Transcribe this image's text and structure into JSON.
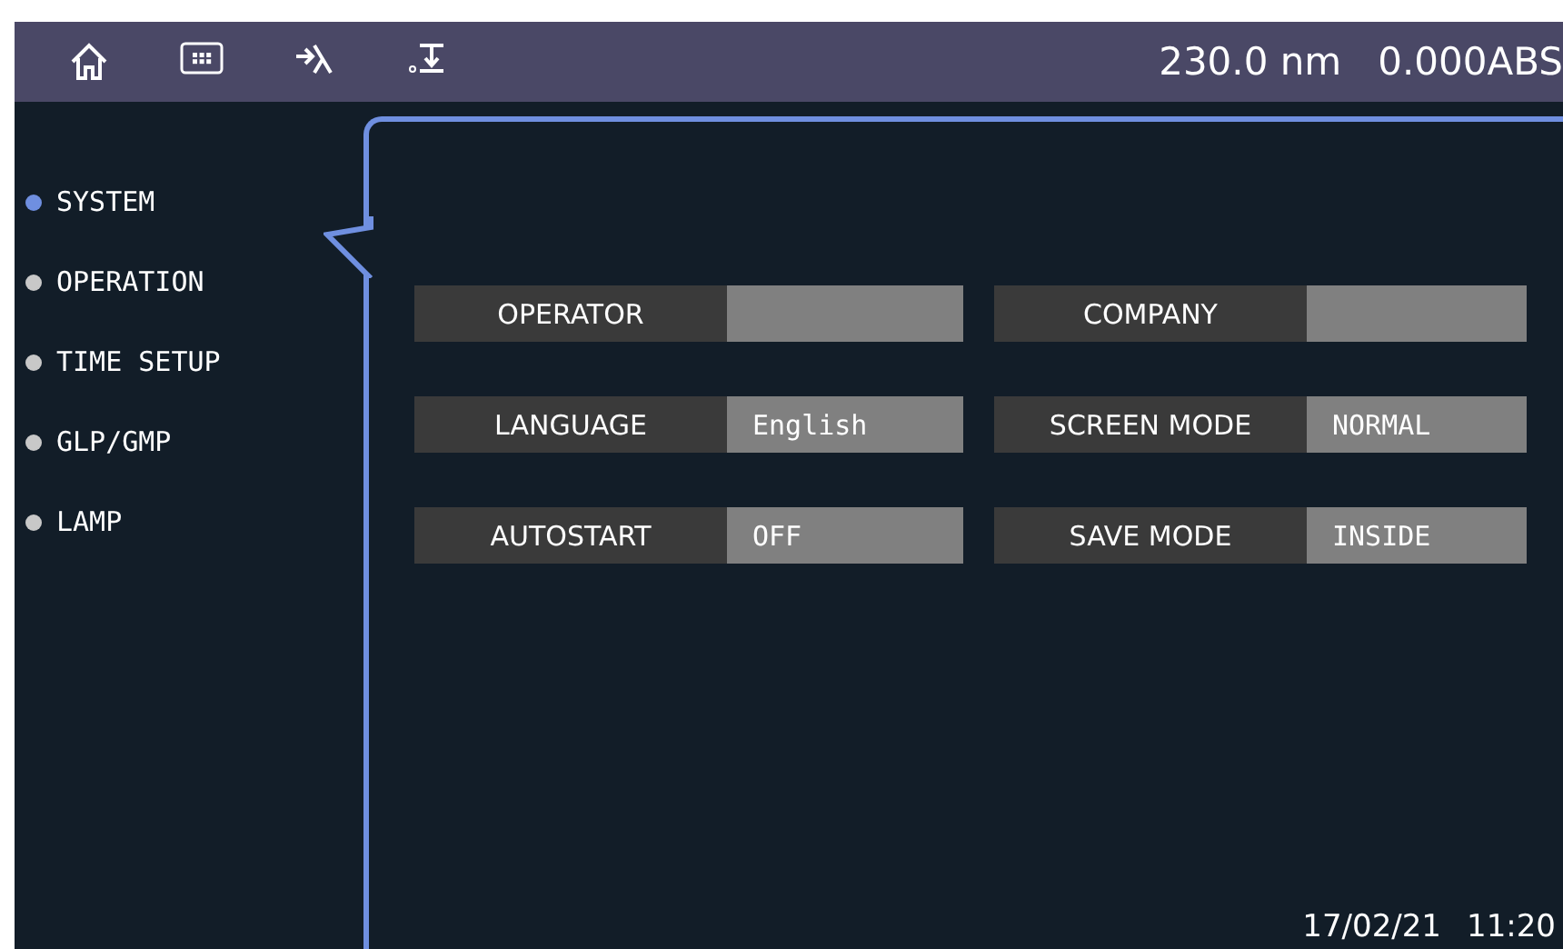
{
  "header": {
    "icons": [
      {
        "kind": "home"
      },
      {
        "kind": "keypad"
      },
      {
        "kind": "goto-wavelength"
      },
      {
        "kind": "zero"
      }
    ],
    "wavelength": "230.0 nm",
    "absorbance": "0.000ABS"
  },
  "sidebar": {
    "items": [
      {
        "label": "SYSTEM",
        "selected": true
      },
      {
        "label": "OPERATION",
        "selected": false
      },
      {
        "label": "TIME SETUP",
        "selected": false
      },
      {
        "label": "GLP/GMP",
        "selected": false
      },
      {
        "label": "LAMP",
        "selected": false
      }
    ]
  },
  "settings": [
    {
      "label": "OPERATOR"
    },
    {
      "label": "COMPANY"
    },
    {
      "label": "LANGUAGE",
      "value": "English"
    },
    {
      "label": "SCREEN MODE",
      "value": "NORMAL"
    },
    {
      "label": "AUTOSTART",
      "value": "OFF"
    },
    {
      "label": "SAVE MODE",
      "value": "INSIDE"
    }
  ],
  "status": {
    "date": "17/02/21",
    "time": "11:20"
  }
}
